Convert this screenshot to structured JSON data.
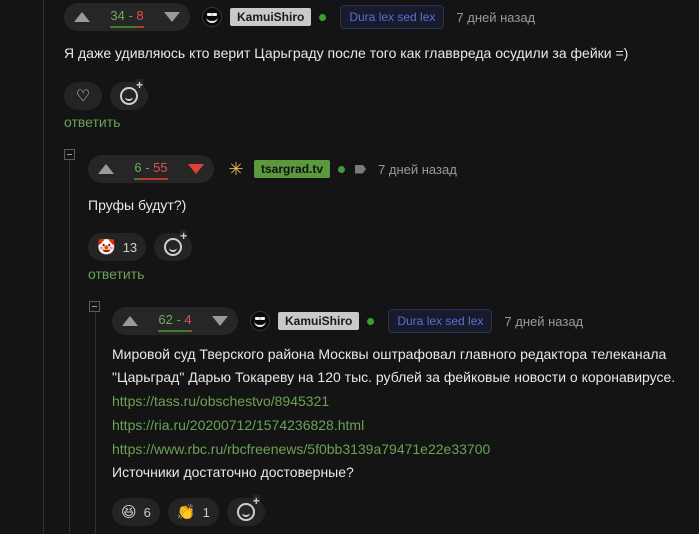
{
  "comments": [
    {
      "rating": {
        "plus": "34",
        "minus": "8"
      },
      "author": "KamuiShiro",
      "badge": "Dura lex sed lex",
      "time": "7 дней назад",
      "text": "Я даже удивляюсь кто верит Царьграду после того как главвреда осудили за фейки =)",
      "reply_label": "ответить"
    },
    {
      "rating": {
        "plus": "6",
        "minus": "55"
      },
      "author": "tsargrad.tv",
      "time": "7 дней назад",
      "text": "Пруфы будут?)",
      "reactions": [
        {
          "icon": "clown-face-icon",
          "count": "13"
        }
      ],
      "reply_label": "ответить"
    },
    {
      "rating": {
        "plus": "62",
        "minus": "4"
      },
      "author": "KamuiShiro",
      "badge": "Dura lex sed lex",
      "time": "7 дней назад",
      "text_line1": "Мировой суд Тверского района Москвы оштрафовал главного редактора телеканала",
      "text_line2": "\"Царьград\" Дарью Токареву на 120 тыс. рублей за фейковые новости о коронавирусе.",
      "links": [
        "https://tass.ru/obschestvo/8945321",
        "https://ria.ru/20200712/1574236828.html",
        "https://www.rbc.ru/rbcfreenews/5f0bb3139a79471e22e33700"
      ],
      "text_tail": "Источники достаточно достоверные?",
      "reactions": [
        {
          "icon": "grinning-face-icon",
          "count": "6"
        },
        {
          "icon": "clapping-hands-icon",
          "count": "1"
        }
      ]
    }
  ],
  "colors": {
    "plus": "#6cae57",
    "minus": "#d9534f",
    "link": "#6aa257",
    "badge": "#5b6fd6"
  }
}
